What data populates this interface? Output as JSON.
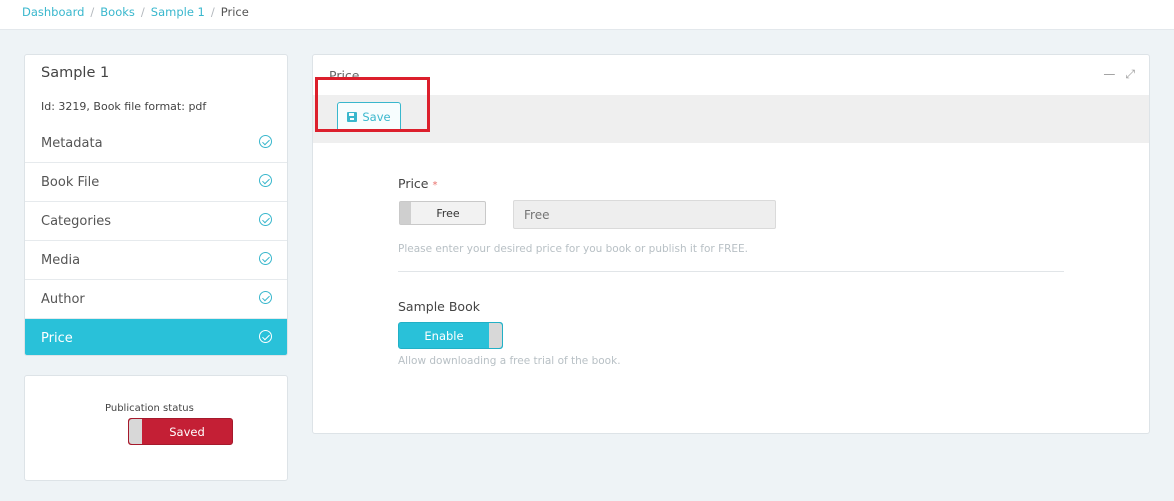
{
  "breadcrumb": {
    "items": [
      "Dashboard",
      "Books",
      "Sample 1"
    ],
    "current": "Price",
    "separator": "/"
  },
  "sidebar": {
    "title": "Sample 1",
    "meta": "Id: 3219, Book file format: pdf",
    "items": [
      {
        "label": "Metadata",
        "complete": true
      },
      {
        "label": "Book File",
        "complete": true
      },
      {
        "label": "Categories",
        "complete": true
      },
      {
        "label": "Media",
        "complete": true
      },
      {
        "label": "Author",
        "complete": true
      },
      {
        "label": "Price",
        "complete": true,
        "active": true
      }
    ]
  },
  "publication": {
    "label": "Publication status",
    "status": "Saved"
  },
  "main": {
    "title": "Price",
    "toolbar": {
      "save_label": "Save"
    },
    "price": {
      "label": "Price",
      "required_mark": "*",
      "toggle_label": "Free",
      "input_placeholder": "Free",
      "help": "Please enter your desired price for you book or publish it for FREE."
    },
    "sample_book": {
      "label": "Sample Book",
      "toggle_label": "Enable",
      "help": "Allow downloading a free trial of the book."
    }
  },
  "icons": {
    "check": "check-circle-icon",
    "save": "floppy-disk-icon",
    "minimize": "minimize-icon",
    "expand": "expand-icon"
  },
  "colors": {
    "accent": "#29c1d9",
    "link": "#39b7cd",
    "status_saved": "#c41f35",
    "highlight": "#dc1f2c"
  }
}
